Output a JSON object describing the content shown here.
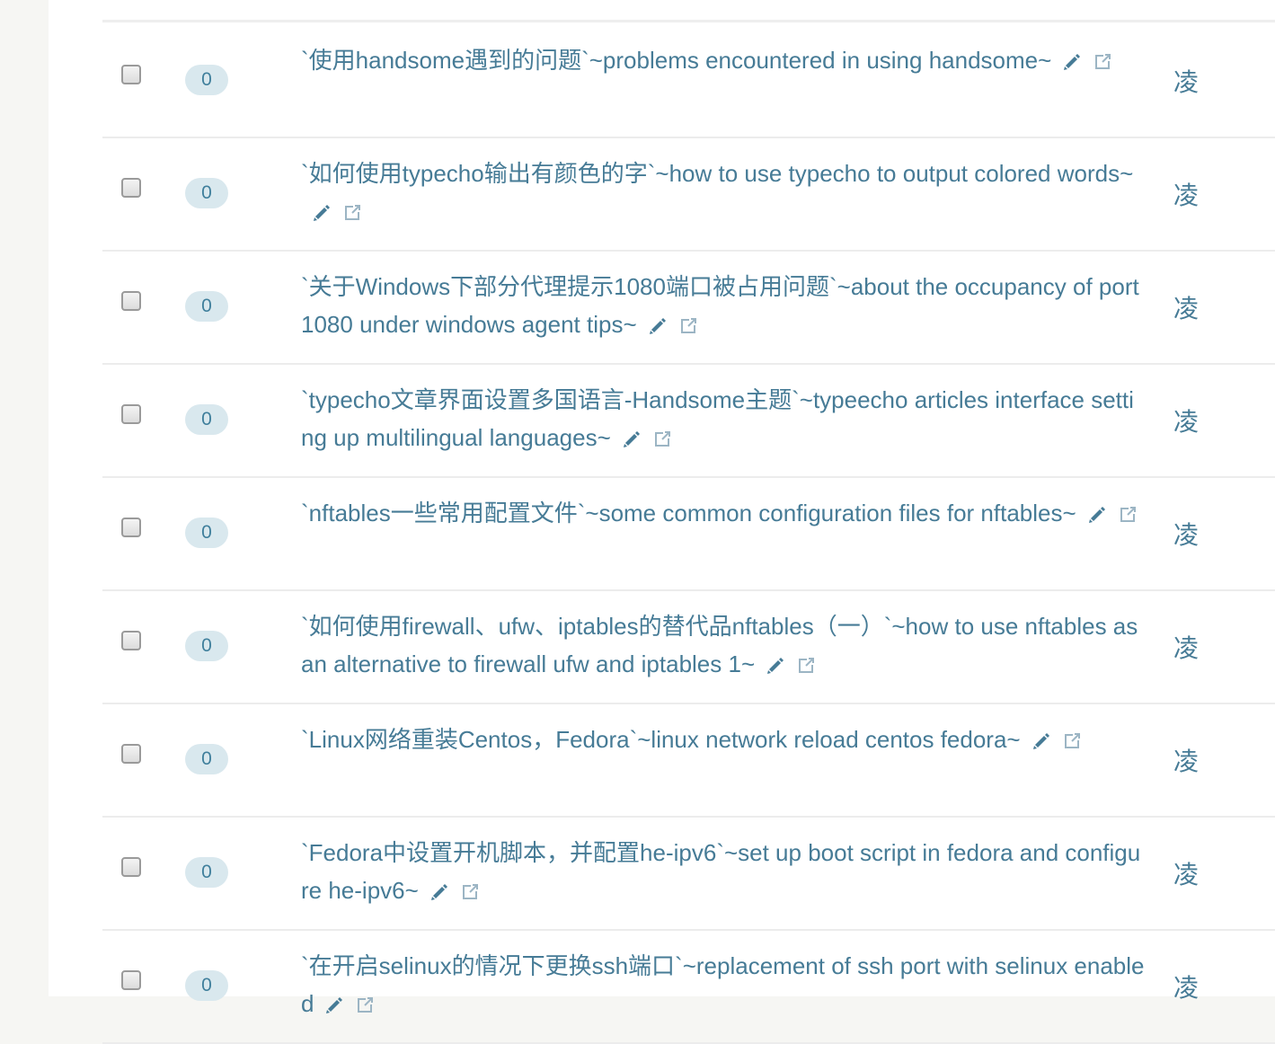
{
  "posts": [
    {
      "count": "0",
      "title": "`使用handsome遇到的问题`~problems encountered in using handsome~",
      "author": "凌"
    },
    {
      "count": "0",
      "title": "`如何使用typecho输出有颜色的字`~how to use typecho to output colored words~",
      "author": "凌"
    },
    {
      "count": "0",
      "title": "`关于Windows下部分代理提示1080端口被占用问题`~about the occupancy of port 1080 under windows agent tips~",
      "author": "凌"
    },
    {
      "count": "0",
      "title": "`typecho文章界面设置多国语言-Handsome主题`~typeecho articles interface setting up multilingual languages~",
      "author": "凌"
    },
    {
      "count": "0",
      "title": "`nftables一些常用配置文件`~some common configuration files for nftables~",
      "author": "凌"
    },
    {
      "count": "0",
      "title": "`如何使用firewall、ufw、iptables的替代品nftables（一）`~how to use nftables as an alternative to firewall ufw and iptables 1~",
      "author": "凌"
    },
    {
      "count": "0",
      "title": "`Linux网络重装Centos，Fedora`~linux network reload centos fedora~",
      "author": "凌"
    },
    {
      "count": "0",
      "title": "`Fedora中设置开机脚本，并配置he-ipv6`~set up boot script in fedora and configure he-ipv6~",
      "author": "凌"
    },
    {
      "count": "0",
      "title": "`在开启selinux的情况下更换ssh端口`~replacement of ssh port with selinux enabled",
      "author": "凌"
    }
  ],
  "colors": {
    "link": "#467b96",
    "badge_bg": "#d9e8ee",
    "divider": "#ececec"
  },
  "icons": {
    "edit": "pencil-icon",
    "open": "external-link-icon"
  }
}
